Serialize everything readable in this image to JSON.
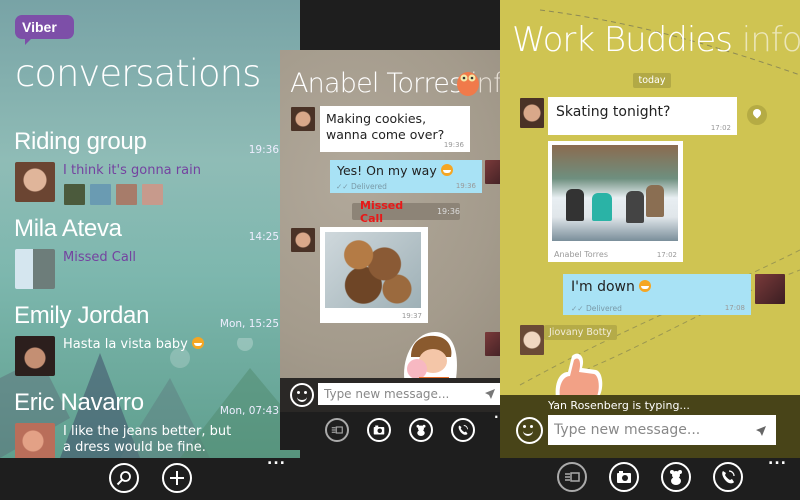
{
  "conversations_screen": {
    "app_logo": "Viber",
    "title": "conversations",
    "items": [
      {
        "name": "Riding group",
        "time": "19:36",
        "preview": "I think it's gonna rain",
        "preview_style": "purple",
        "avatar_color": "#a0735a",
        "group_member_colors": [
          "#4b5a3c",
          "#6a9bb2",
          "#a77c6a",
          "#c79a8c"
        ]
      },
      {
        "name": "Mila Ateva",
        "time": "14:25",
        "preview": "Missed Call",
        "preview_style": "purple",
        "avatar_color": "#8fb2c9"
      },
      {
        "name": "Emily Jordan",
        "time": "Mon, 15:25",
        "preview": "Hasta la vista baby",
        "preview_style": "white",
        "preview_emoji": "winking-face-tongue",
        "avatar_color": "#5a3b34"
      },
      {
        "name": "Eric Navarro",
        "time": "Mon, 07:43",
        "preview": "I like the jeans better, but a dress would be fine.",
        "preview_style": "white",
        "avatar_color": "#b96e5a"
      }
    ],
    "appbar": {
      "buttons": [
        {
          "icon": "search-icon"
        },
        {
          "icon": "plus-icon"
        }
      ],
      "more": "..."
    }
  },
  "chat_anabel": {
    "title": "Anabel Torres",
    "info_label": "info",
    "messages": [
      {
        "direction": "in",
        "text": "Making cookies, wanna come over?",
        "time": "19:36",
        "avatar_color": "#6b4a3a"
      },
      {
        "direction": "out",
        "text": "Yes! On my way",
        "emoji": "grinning-face",
        "status": "Delivered",
        "time": "19:36",
        "avatar_color": "#5a2a30"
      },
      {
        "type": "missed-call",
        "label": "Missed Call",
        "time": "19:36"
      },
      {
        "direction": "in",
        "type": "photo",
        "subject": "cookies",
        "time": "19:37",
        "avatar_color": "#6b4a3a"
      },
      {
        "direction": "out",
        "type": "sticker",
        "subject": "boy-blowing-bubble",
        "avatar_color": "#5a2a30"
      }
    ],
    "input": {
      "placeholder": "Type new message..."
    },
    "appbar": {
      "buttons": [
        {
          "icon": "sms-icon"
        },
        {
          "icon": "camera-icon"
        },
        {
          "icon": "sticker-bear-icon"
        },
        {
          "icon": "viber-call-icon"
        }
      ],
      "more": "..."
    }
  },
  "chat_work_buddies": {
    "title": "Work Buddies",
    "info_label": "info",
    "date_divider": "today",
    "messages": [
      {
        "direction": "in",
        "text": "Skating tonight?",
        "time": "17:02",
        "avatar_color": "#6b4a3a",
        "has_location": true
      },
      {
        "direction": "in",
        "type": "photo",
        "subject": "ice-skating-rink",
        "sender": "Anabel Torres",
        "time": "17:02"
      },
      {
        "direction": "out",
        "text": "I'm down",
        "emoji": "grinning-face",
        "status": "Delivered",
        "time": "17:08",
        "avatar_color": "#5a2a30"
      },
      {
        "direction": "in",
        "type": "sticker",
        "subject": "thumbs-up",
        "sender": "Jiovany Botty",
        "avatar_color": "#e7d5c3"
      }
    ],
    "typing_indicator": "Yan Rosenberg is typing...",
    "input": {
      "placeholder": "Type new message..."
    },
    "appbar": {
      "buttons": [
        {
          "icon": "sms-icon"
        },
        {
          "icon": "camera-icon"
        },
        {
          "icon": "sticker-bear-icon"
        },
        {
          "icon": "viber-call-icon"
        }
      ],
      "more": "..."
    }
  }
}
